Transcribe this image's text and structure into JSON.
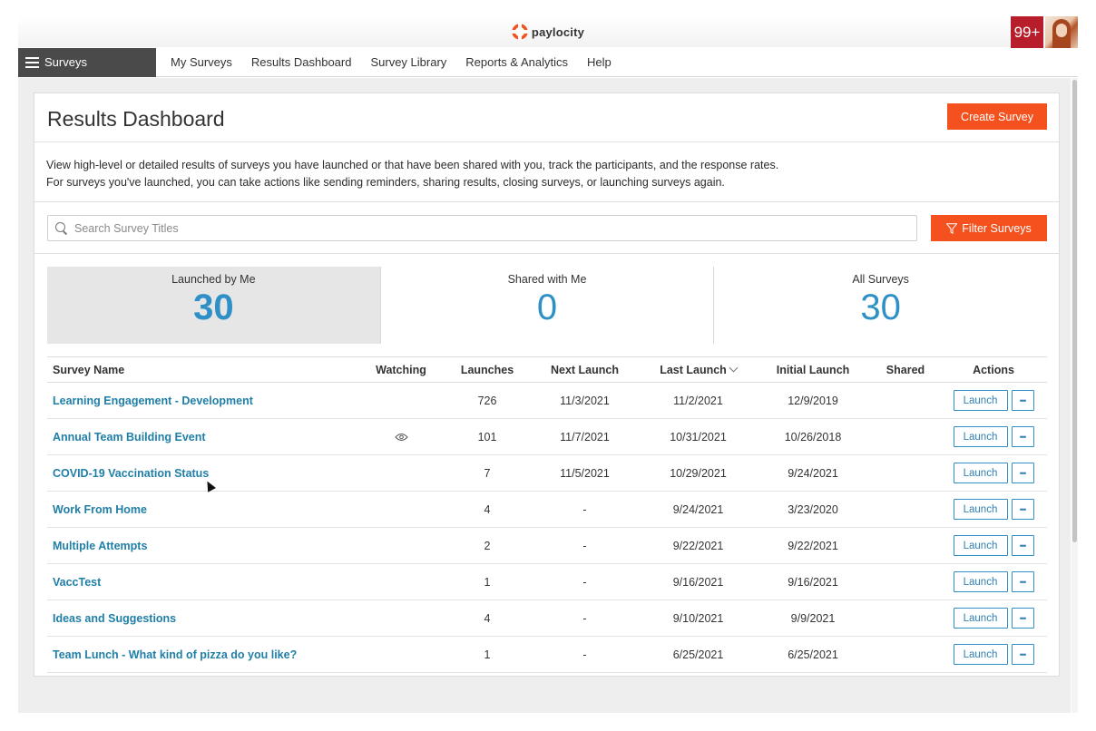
{
  "brand": {
    "name": "paylocity",
    "notification_count": "99+"
  },
  "nav": {
    "module_label": "Surveys",
    "items": [
      {
        "label": "My Surveys"
      },
      {
        "label": "Results Dashboard"
      },
      {
        "label": "Survey Library"
      },
      {
        "label": "Reports & Analytics"
      },
      {
        "label": "Help"
      }
    ]
  },
  "page": {
    "title": "Results Dashboard",
    "create_button": "Create Survey",
    "description_line1": "View high-level or detailed results of surveys you have launched or that have been shared with you, track the participants, and the response rates.",
    "description_line2": "For surveys you've launched, you can take actions like sending reminders, sharing results, closing surveys, or launching surveys again."
  },
  "search": {
    "placeholder": "Search Survey Titles",
    "filter_button": "Filter Surveys"
  },
  "stats": [
    {
      "label": "Launched by Me",
      "value": "30",
      "active": true
    },
    {
      "label": "Shared with Me",
      "value": "0",
      "active": false
    },
    {
      "label": "All Surveys",
      "value": "30",
      "active": false
    }
  ],
  "table": {
    "headers": {
      "survey_name": "Survey Name",
      "watching": "Watching",
      "launches": "Launches",
      "next_launch": "Next Launch",
      "last_launch": "Last Launch",
      "initial_launch": "Initial Launch",
      "shared": "Shared",
      "actions": "Actions"
    },
    "launch_label": "Launch",
    "more_label": "•••",
    "rows": [
      {
        "name": "Learning Engagement - Development",
        "watching": false,
        "launches": "726",
        "next_launch": "11/3/2021",
        "last_launch": "11/2/2021",
        "initial_launch": "12/9/2019",
        "shared": ""
      },
      {
        "name": "Annual Team Building Event",
        "watching": true,
        "launches": "101",
        "next_launch": "11/7/2021",
        "last_launch": "10/31/2021",
        "initial_launch": "10/26/2018",
        "shared": ""
      },
      {
        "name": "COVID-19 Vaccination Status",
        "watching": false,
        "launches": "7",
        "next_launch": "11/5/2021",
        "last_launch": "10/29/2021",
        "initial_launch": "9/24/2021",
        "shared": ""
      },
      {
        "name": "Work From Home",
        "watching": false,
        "launches": "4",
        "next_launch": "-",
        "last_launch": "9/24/2021",
        "initial_launch": "3/23/2020",
        "shared": ""
      },
      {
        "name": "Multiple Attempts",
        "watching": false,
        "launches": "2",
        "next_launch": "-",
        "last_launch": "9/22/2021",
        "initial_launch": "9/22/2021",
        "shared": ""
      },
      {
        "name": "VaccTest",
        "watching": false,
        "launches": "1",
        "next_launch": "-",
        "last_launch": "9/16/2021",
        "initial_launch": "9/16/2021",
        "shared": ""
      },
      {
        "name": "Ideas and Suggestions",
        "watching": false,
        "launches": "4",
        "next_launch": "-",
        "last_launch": "9/10/2021",
        "initial_launch": "9/9/2021",
        "shared": ""
      },
      {
        "name": "Team Lunch - What kind of pizza do you like?",
        "watching": false,
        "launches": "1",
        "next_launch": "-",
        "last_launch": "6/25/2021",
        "initial_launch": "6/25/2021",
        "shared": ""
      }
    ]
  },
  "colors": {
    "accent_orange": "#f4511e",
    "link_blue": "#1f7fa8",
    "stat_blue": "#2e90c7",
    "nav_dark": "#4a4a4a",
    "notification_red": "#b71d2a"
  }
}
